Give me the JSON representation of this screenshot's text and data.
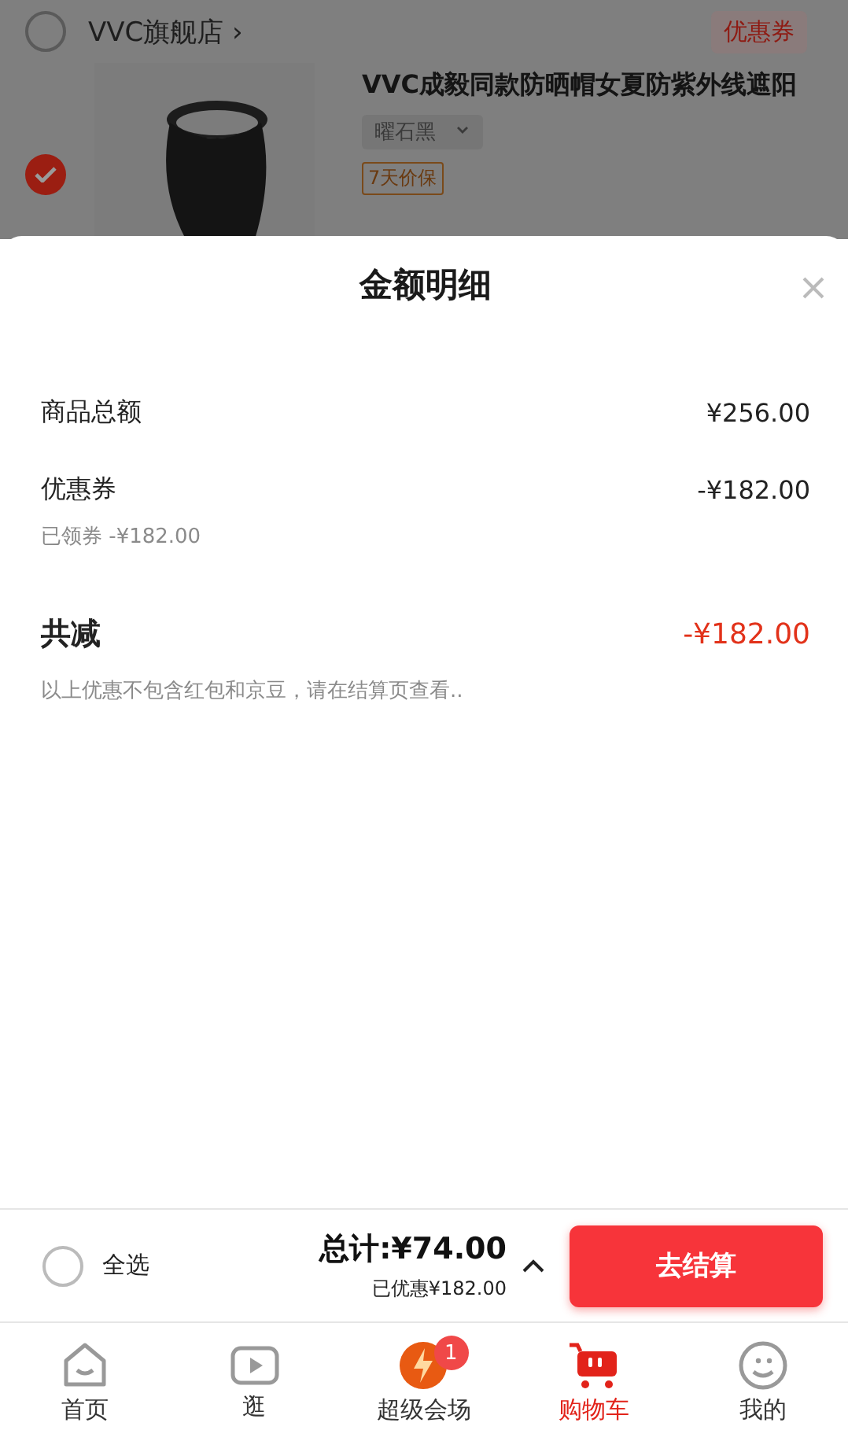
{
  "store": {
    "name": "VVC旗舰店",
    "chevron": "›",
    "selected": false,
    "coupon": "优惠券"
  },
  "product": {
    "selected": true,
    "title": "VVC成毅同款防晒帽女夏防紫外线遮阳",
    "variant": "曜石黑",
    "tag": "7天价保"
  },
  "sheet": {
    "title": "金额明细",
    "rows": [
      {
        "label": "商品总额",
        "value": "¥256.00"
      },
      {
        "label": "优惠券",
        "value": "-¥182.00",
        "note": "已领券 -¥182.00"
      }
    ],
    "total": {
      "label": "共减",
      "value": "-¥182.00"
    },
    "disclaimer": "以上优惠不包含红包和京豆，请在结算页查看.."
  },
  "footer": {
    "select_all": {
      "label": "全选",
      "checked": false
    },
    "total": "总计:¥74.00",
    "saved": "已优惠¥182.00",
    "checkout": "去结算"
  },
  "tabs": [
    {
      "label": "首页",
      "kind": "home",
      "selected": false
    },
    {
      "label": "逛",
      "kind": "video",
      "selected": false
    },
    {
      "label": "超级会场",
      "kind": "promo",
      "selected": false,
      "badge": "1"
    },
    {
      "label": "购物车",
      "kind": "cart",
      "selected": true
    },
    {
      "label": "我的",
      "kind": "profile",
      "selected": false
    }
  ]
}
